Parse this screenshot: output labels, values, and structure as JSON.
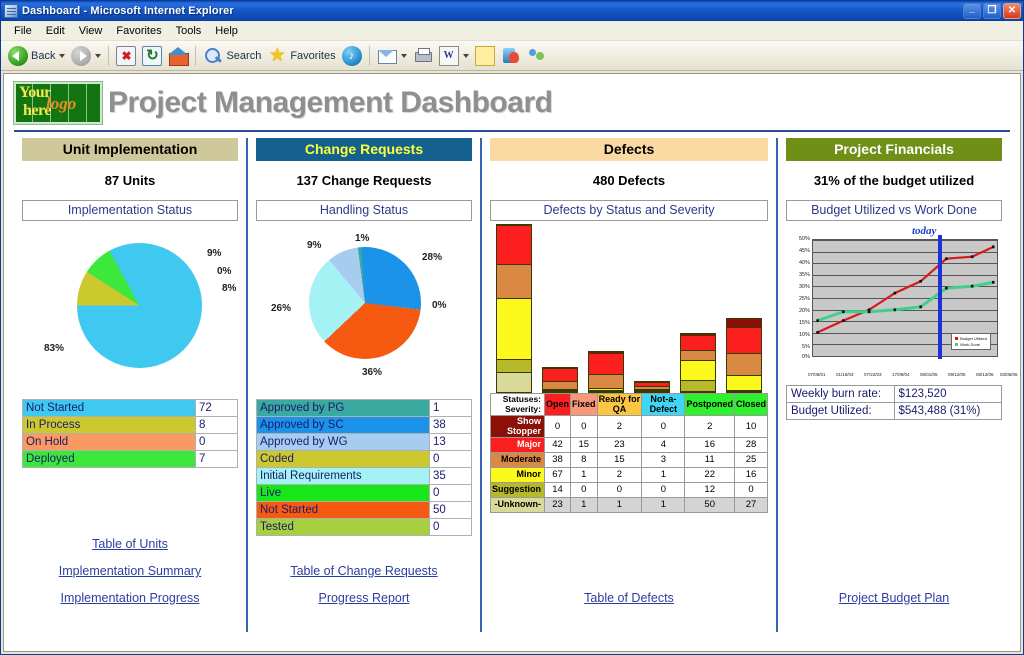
{
  "window": {
    "title": "Dashboard - Microsoft Internet Explorer",
    "minimize": "_",
    "maximize": "❐",
    "close": "✕"
  },
  "menu": [
    "File",
    "Edit",
    "View",
    "Favorites",
    "Tools",
    "Help"
  ],
  "toolbar": {
    "back": "Back",
    "search": "Search",
    "favorites": "Favorites",
    "icons": [
      "back-icon",
      "forward-icon",
      "stop-icon",
      "refresh-icon",
      "home-icon",
      "search-icon",
      "favorites-star-icon",
      "media-icon",
      "mail-icon",
      "print-icon",
      "edit-icon",
      "note-icon",
      "messenger-icon",
      "people-icon"
    ]
  },
  "header": {
    "logo_line1": "Your",
    "logo_line2": "here",
    "logo_accent": "logo",
    "title": "Project Management Dashboard"
  },
  "panels": [
    {
      "id": "unit-implementation",
      "heading": "Unit Implementation",
      "count_text": "87 Units",
      "chart_title": "Implementation Status",
      "legend": [
        {
          "label": "Not Started",
          "value": "72",
          "color": "#3fc8f0"
        },
        {
          "label": "In Process",
          "value": "8",
          "color": "#ccc92e"
        },
        {
          "label": "On Hold",
          "value": "0",
          "color": "#fa9a63"
        },
        {
          "label": "Deployed",
          "value": "7",
          "color": "#3ce83c"
        }
      ],
      "links": [
        "Table of Units",
        "Implementation Summary",
        "Implementation Progress"
      ]
    },
    {
      "id": "change-requests",
      "heading": "Change Requests",
      "count_text": "137 Change Requests",
      "chart_title": "Handling Status",
      "legend": [
        {
          "label": "Approved by PG",
          "value": "1",
          "color": "#3aa9a0"
        },
        {
          "label": "Approved by SC",
          "value": "38",
          "color": "#1b93e8"
        },
        {
          "label": "Approved by WG",
          "value": "13",
          "color": "#a6cdf0"
        },
        {
          "label": "Coded",
          "value": "0",
          "color": "#ccc92e"
        },
        {
          "label": "Initial Requirements",
          "value": "35",
          "color": "#a5f2f5"
        },
        {
          "label": "Live",
          "value": "0",
          "color": "#17e617"
        },
        {
          "label": "Not Started",
          "value": "50",
          "color": "#f65a11"
        },
        {
          "label": "Tested",
          "value": "0",
          "color": "#a7cf3e"
        }
      ],
      "links": [
        "Table of Change Requests",
        "Progress Report"
      ]
    },
    {
      "id": "defects",
      "heading": "Defects",
      "count_text": "480 Defects",
      "chart_title": "Defects by Status and Severity",
      "links": [
        "Table of Defects"
      ]
    },
    {
      "id": "project-financials",
      "heading": "Project Financials",
      "count_text": "31% of the budget utilized",
      "chart_title": "Budget Utilized vs Work Done",
      "today_label": "today",
      "table": [
        {
          "label": "Weekly burn rate:",
          "value": "$123,520"
        },
        {
          "label": "Budget Utilized:",
          "value": "$543,488 (31%)"
        }
      ],
      "links": [
        "Project Budget Plan"
      ]
    }
  ],
  "chart_data": [
    {
      "type": "pie",
      "id": "implementation-status-pie",
      "title": "Implementation Status",
      "labels": [
        "Not Started",
        "In Process",
        "On Hold",
        "Deployed"
      ],
      "values": [
        72,
        8,
        0,
        7
      ],
      "percent_labels": [
        "83%",
        "9%",
        "0%",
        "8%"
      ],
      "colors": [
        "#3fc8f0",
        "#ccc92e",
        "#fa9a63",
        "#3ce83c"
      ],
      "legend_position": "below-as-table"
    },
    {
      "type": "pie",
      "id": "handling-status-pie",
      "title": "Handling Status",
      "labels": [
        "Approved by PG",
        "Approved by SC",
        "Approved by WG",
        "Coded",
        "Initial Requirements",
        "Live",
        "Not Started",
        "Tested"
      ],
      "values": [
        1,
        38,
        13,
        0,
        35,
        0,
        50,
        0
      ],
      "percent_labels": [
        "1%",
        "28%",
        "9%",
        "0%",
        "26%",
        "0%",
        "36%",
        "0%"
      ],
      "colors": [
        "#3aa9a0",
        "#1b93e8",
        "#a6cdf0",
        "#ccc92e",
        "#a5f2f5",
        "#17e617",
        "#f65a11",
        "#a7cf3e"
      ],
      "legend_position": "below-as-table"
    },
    {
      "type": "bar",
      "id": "defects-by-status-severity",
      "title": "Defects by Status and Severity",
      "stacked": true,
      "corner_label_1": "Statuses:",
      "corner_label_2": "Severity:",
      "categories": [
        "Open",
        "Fixed",
        "Ready for QA",
        "Not-a-Defect",
        "Postponed",
        "Closed"
      ],
      "category_colors": [
        "#fb1f1f",
        "#f79878",
        "#fbc544",
        "#3fd6f5",
        "#2ef02e",
        "#2ef02e"
      ],
      "series": [
        {
          "name": "Show Stopper",
          "color": "#8b1007",
          "values": [
            0,
            0,
            2,
            0,
            2,
            10
          ]
        },
        {
          "name": "Major",
          "color": "#fb1f1f",
          "values": [
            42,
            15,
            23,
            4,
            16,
            28
          ]
        },
        {
          "name": "Moderate",
          "color": "#d98943",
          "values": [
            38,
            8,
            15,
            3,
            11,
            25
          ]
        },
        {
          "name": "Minor",
          "color": "#fbf81b",
          "values": [
            67,
            1,
            2,
            1,
            22,
            16
          ]
        },
        {
          "name": "Suggestion",
          "color": "#b8b82b",
          "values": [
            14,
            0,
            0,
            0,
            12,
            0
          ]
        },
        {
          "name": "-Unknown-",
          "color": "#d9d99a",
          "values": [
            23,
            1,
            1,
            1,
            50,
            27
          ]
        }
      ],
      "xlabel": "",
      "ylabel": ""
    },
    {
      "type": "line",
      "id": "budget-utilized-vs-work-done",
      "title": "Budget Utilized vs Work Done",
      "annotation": "today",
      "ylabel": "",
      "xlabel": "",
      "ylim": [
        0,
        50
      ],
      "yticks": [
        "0%",
        "5%",
        "10%",
        "15%",
        "20%",
        "25%",
        "30%",
        "35%",
        "40%",
        "45%",
        "50%"
      ],
      "x": [
        "07/08/01",
        "01/15/03",
        "07/22/03",
        "17/09/04",
        "08/01/05",
        "09/12/05",
        "08/13/06",
        "03/06/06"
      ],
      "series": [
        {
          "name": "Budget Utilized",
          "color": "#d61a1a",
          "values": [
            10,
            15,
            20,
            27,
            32,
            42,
            43,
            47
          ]
        },
        {
          "name": "Work Done",
          "color": "#3fd18a",
          "values": [
            15,
            19,
            19,
            20,
            21,
            29,
            30,
            32
          ]
        }
      ],
      "grid": true,
      "legend_position": "bottom-right"
    }
  ]
}
